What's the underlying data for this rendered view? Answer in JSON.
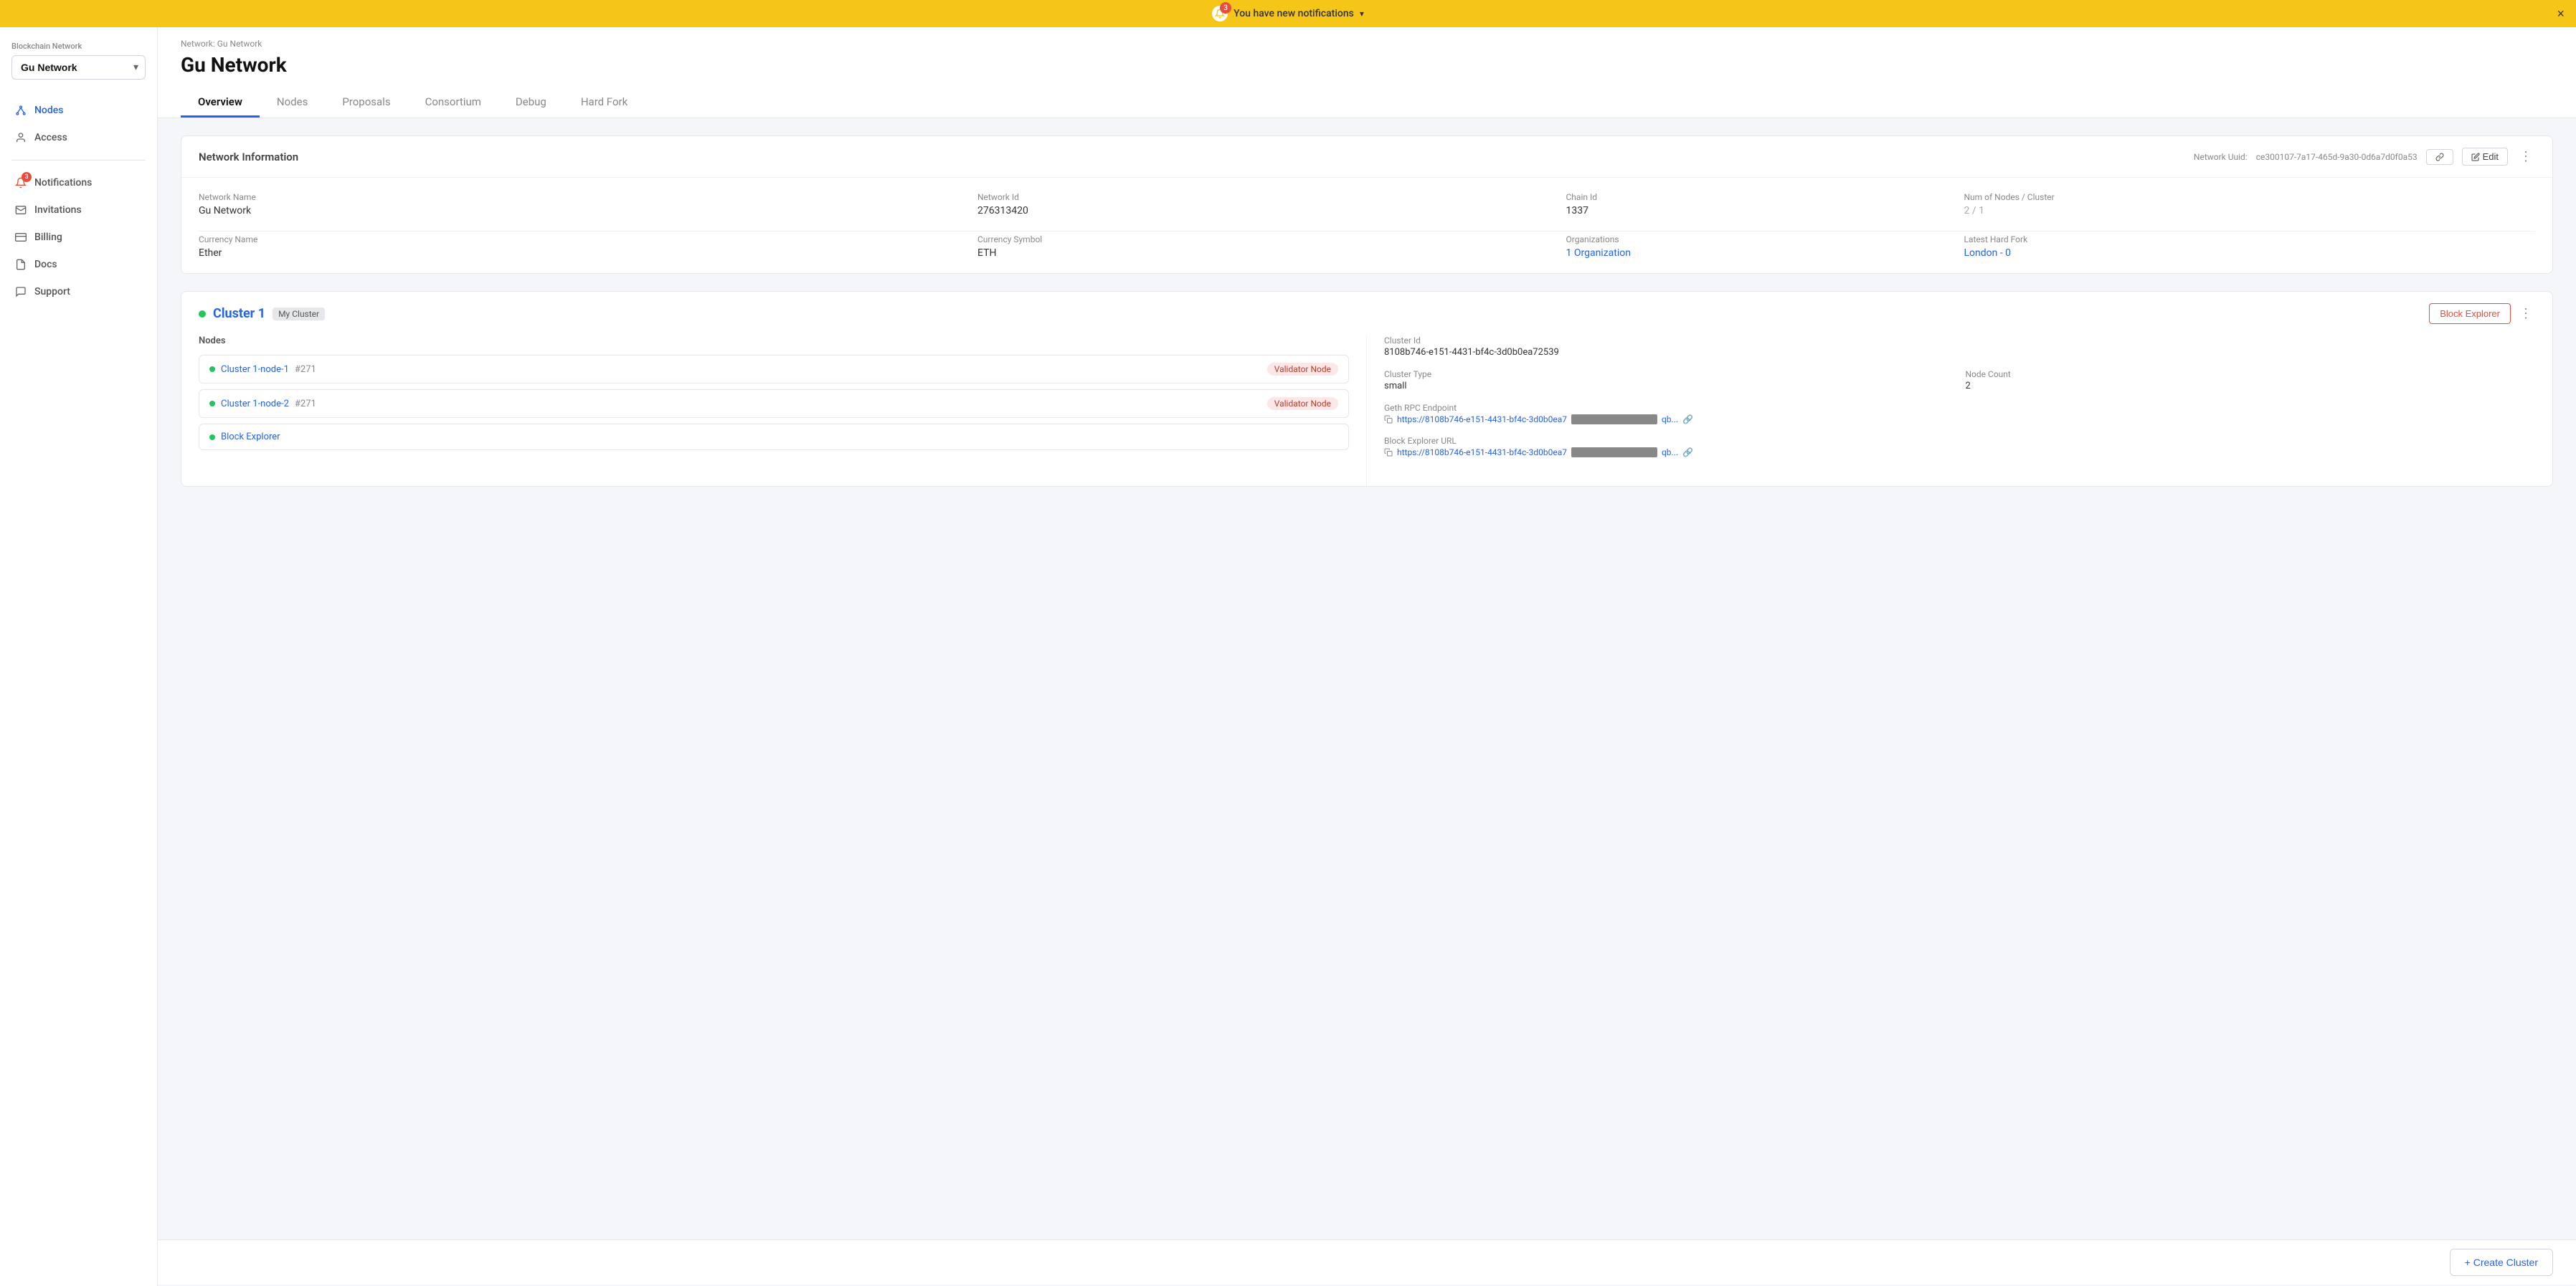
{
  "notification_bar": {
    "badge_count": "3",
    "message": "You have new notifications",
    "chevron": "▾",
    "close": "×"
  },
  "sidebar": {
    "network_label": "Blockchain Network",
    "network_name": "Gu Network",
    "items": [
      {
        "id": "nodes",
        "label": "Nodes",
        "icon": "nodes",
        "active": true,
        "badge": null
      },
      {
        "id": "access",
        "label": "Access",
        "icon": "access",
        "active": false,
        "badge": null
      },
      {
        "id": "notifications",
        "label": "Notifications",
        "icon": "bell",
        "active": false,
        "badge": "3"
      },
      {
        "id": "invitations",
        "label": "Invitations",
        "icon": "mail",
        "active": false,
        "badge": null
      },
      {
        "id": "billing",
        "label": "Billing",
        "icon": "credit-card",
        "active": false,
        "badge": null
      },
      {
        "id": "docs",
        "label": "Docs",
        "icon": "doc",
        "active": false,
        "badge": null
      },
      {
        "id": "support",
        "label": "Support",
        "icon": "chat",
        "active": false,
        "badge": null
      }
    ]
  },
  "header": {
    "breadcrumb": "Network: Gu Network",
    "title": "Gu Network"
  },
  "tabs": [
    {
      "id": "overview",
      "label": "Overview",
      "active": true
    },
    {
      "id": "nodes",
      "label": "Nodes",
      "active": false
    },
    {
      "id": "proposals",
      "label": "Proposals",
      "active": false
    },
    {
      "id": "consortium",
      "label": "Consortium",
      "active": false
    },
    {
      "id": "debug",
      "label": "Debug",
      "active": false
    },
    {
      "id": "hard-fork",
      "label": "Hard Fork",
      "active": false
    }
  ],
  "network_info": {
    "section_title": "Network Information",
    "uuid_label": "Network Uuid:",
    "uuid_value": "ce300107-7a17-465d-9a30-0d6a7d0f0a53",
    "edit_label": "Edit",
    "fields_row1": [
      {
        "label": "Network Name",
        "value": "Gu Network",
        "type": "normal"
      },
      {
        "label": "Network Id",
        "value": "276313420",
        "type": "normal"
      },
      {
        "label": "Chain Id",
        "value": "1337",
        "type": "normal"
      },
      {
        "label": "Num of Nodes / Cluster",
        "value": "2 / 1",
        "type": "muted"
      }
    ],
    "fields_row2": [
      {
        "label": "Currency Name",
        "value": "Ether",
        "type": "normal"
      },
      {
        "label": "Currency Symbol",
        "value": "ETH",
        "type": "normal"
      },
      {
        "label": "Organizations",
        "value": "1 Organization",
        "type": "link"
      },
      {
        "label": "Latest Hard Fork",
        "value": "London - 0",
        "type": "link"
      }
    ]
  },
  "cluster": {
    "dot_color": "#22c55e",
    "title": "Cluster 1",
    "badge": "My Cluster",
    "block_explorer_btn": "Block Explorer",
    "nodes_label": "Nodes",
    "nodes": [
      {
        "name": "Cluster 1-node-1",
        "id": "#271",
        "badge": "Validator Node"
      },
      {
        "name": "Cluster 1-node-2",
        "id": "#271",
        "badge": "Validator Node"
      }
    ],
    "block_explorer_item": "Block Explorer",
    "info": {
      "cluster_id_label": "Cluster Id",
      "cluster_id_value": "8108b746-e151-4431-bf4c-3d0b0ea72539",
      "cluster_type_label": "Cluster Type",
      "cluster_type_value": "small",
      "node_count_label": "Node Count",
      "node_count_value": "2",
      "geth_rpc_label": "Geth RPC Endpoint",
      "geth_rpc_prefix": "https://8108b746-e151-4431-bf4c-3d0b0ea7",
      "geth_rpc_suffix": "qb...",
      "block_explorer_url_label": "Block Explorer URL",
      "block_explorer_url_prefix": "https://8108b746-e151-4431-bf4c-3d0b0ea7",
      "block_explorer_url_suffix": "qb..."
    }
  },
  "footer": {
    "create_cluster_label": "+ Create Cluster"
  }
}
